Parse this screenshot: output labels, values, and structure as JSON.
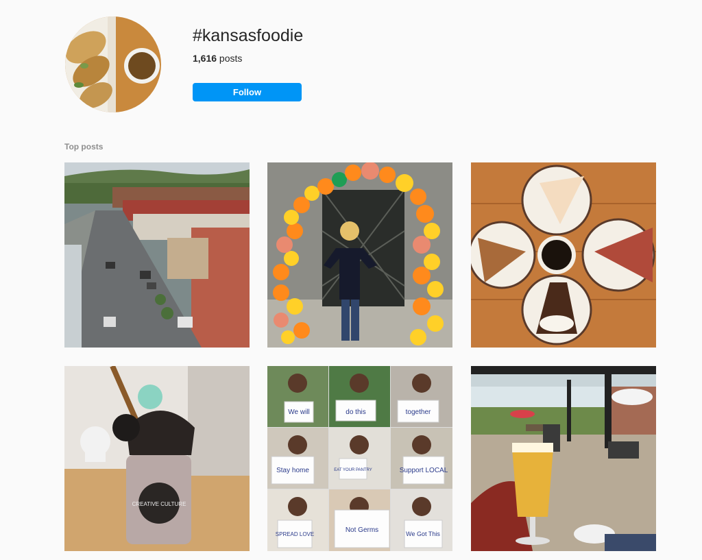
{
  "header": {
    "hashtag": "#kansasfoodie",
    "post_count": "1,616",
    "post_count_suffix": " posts",
    "follow_label": "Follow"
  },
  "sections": {
    "top_posts_label": "Top posts"
  },
  "posts": [
    {
      "subject": "downtown-street-aerial-photo"
    },
    {
      "subject": "woman-balloon-arch-photo",
      "palette": [
        "#ff8a1c",
        "#ffd028",
        "#e98a70",
        "#1e9e55"
      ]
    },
    {
      "subject": "pie-slices-and-coffee-photo"
    },
    {
      "subject": "cookies-and-cream-milkshake-photo",
      "mug_text": "CREATIVE CULTURE"
    },
    {
      "subject": "support-local-sign-collage-photo",
      "signs": [
        "We will",
        "do this",
        "together",
        "Stay home",
        "EAT YOUR PANTRY",
        "Support LOCAL",
        "SPREAD LOVE",
        "Not Germs",
        "We Got This"
      ]
    },
    {
      "subject": "beer-on-patio-photo"
    }
  ]
}
